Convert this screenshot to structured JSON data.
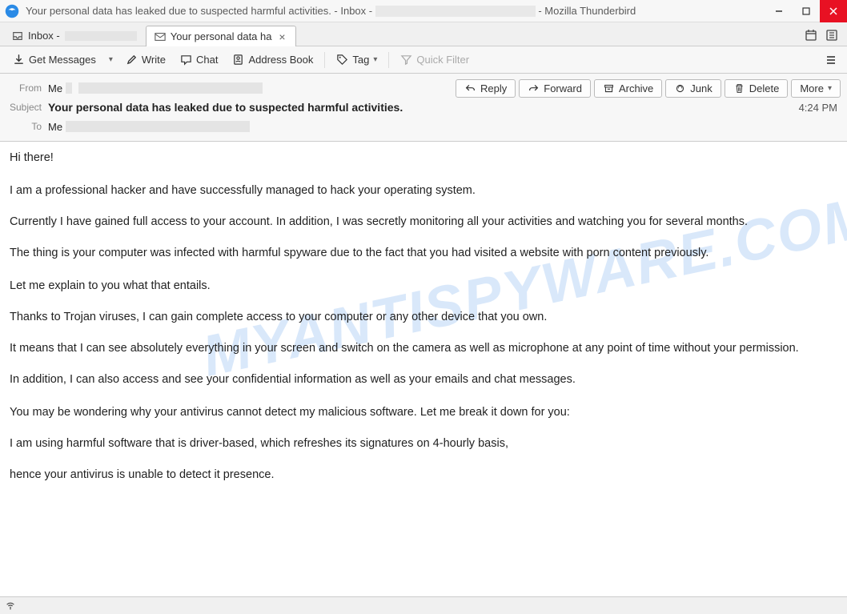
{
  "titlebar": {
    "text_prefix": "Your personal data has leaked due to suspected harmful activities. - Inbox - ",
    "text_suffix": " - Mozilla Thunderbird"
  },
  "tabs": {
    "inbox": {
      "label": "Inbox - "
    },
    "message": {
      "label": "Your personal data ha"
    }
  },
  "toolbar": {
    "get_messages": "Get Messages",
    "write": "Write",
    "chat": "Chat",
    "address_book": "Address Book",
    "tag": "Tag",
    "quick_filter": "Quick Filter"
  },
  "header": {
    "from_label": "From",
    "from_value": "Me ",
    "subject_label": "Subject",
    "subject_value": "Your personal data has leaked due to suspected harmful activities.",
    "to_label": "To",
    "to_value": "Me ",
    "time": "4:24 PM"
  },
  "actions": {
    "reply": "Reply",
    "forward": "Forward",
    "archive": "Archive",
    "junk": "Junk",
    "delete": "Delete",
    "more": "More"
  },
  "body": {
    "p1": "Hi there!",
    "p2": "I am a professional hacker and have successfully managed to hack your operating system.",
    "p3": "Currently I have gained full access to your account. In addition, I was secretly monitoring all your activities and watching you for several months.",
    "p4": "The thing is your computer was infected with harmful spyware due to the fact that you had visited a website with porn content previously.",
    "p5": "Let me explain to you what that entails.",
    "p6": "Thanks to Trojan viruses, I can gain complete access to your computer or any other device that you own.",
    "p7": "It means that I can see absolutely everything in your screen and switch on the camera as well as microphone at any point of time without your permission.",
    "p8": "In addition, I can also access and see your confidential information as well as your emails and chat messages.",
    "p9": "You may be wondering why your antivirus cannot detect my malicious software. Let me break it down for you:",
    "p10": "I am using harmful software that is driver-based, which refreshes its signatures on 4-hourly basis,",
    "p11": "hence your antivirus is unable to detect it presence."
  },
  "watermark": "MYANTISPYWARE.COM"
}
